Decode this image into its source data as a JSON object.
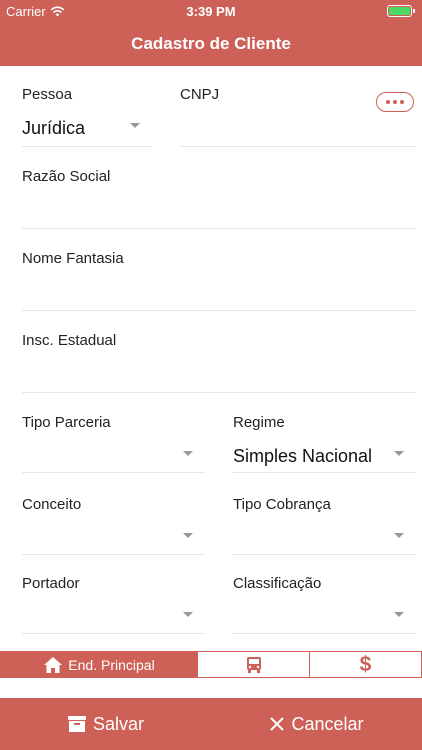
{
  "status": {
    "carrier": "Carrier",
    "time": "3:39 PM"
  },
  "nav": {
    "title": "Cadastro de Cliente"
  },
  "form": {
    "pessoa": {
      "label": "Pessoa",
      "value": "Jurídica"
    },
    "cnpj": {
      "label": "CNPJ",
      "value": ""
    },
    "razao_social": {
      "label": "Razão Social",
      "value": ""
    },
    "nome_fantasia": {
      "label": "Nome Fantasia",
      "value": ""
    },
    "insc_estadual": {
      "label": "Insc. Estadual",
      "value": ""
    },
    "tipo_parceria": {
      "label": "Tipo Parceria",
      "value": ""
    },
    "regime": {
      "label": "Regime",
      "value": "Simples Nacional"
    },
    "conceito": {
      "label": "Conceito",
      "value": ""
    },
    "tipo_cobranca": {
      "label": "Tipo Cobrança",
      "value": ""
    },
    "portador": {
      "label": "Portador",
      "value": ""
    },
    "classificacao": {
      "label": "Classificação",
      "value": ""
    }
  },
  "tabs": [
    {
      "label": "End. Principal",
      "icon": "home-icon"
    },
    {
      "label": "",
      "icon": "bus-icon"
    },
    {
      "label": "",
      "icon": "dollar-icon"
    }
  ],
  "footer": {
    "save_label": "Salvar",
    "cancel_label": "Cancelar"
  },
  "colors": {
    "accent": "#cd6158"
  }
}
